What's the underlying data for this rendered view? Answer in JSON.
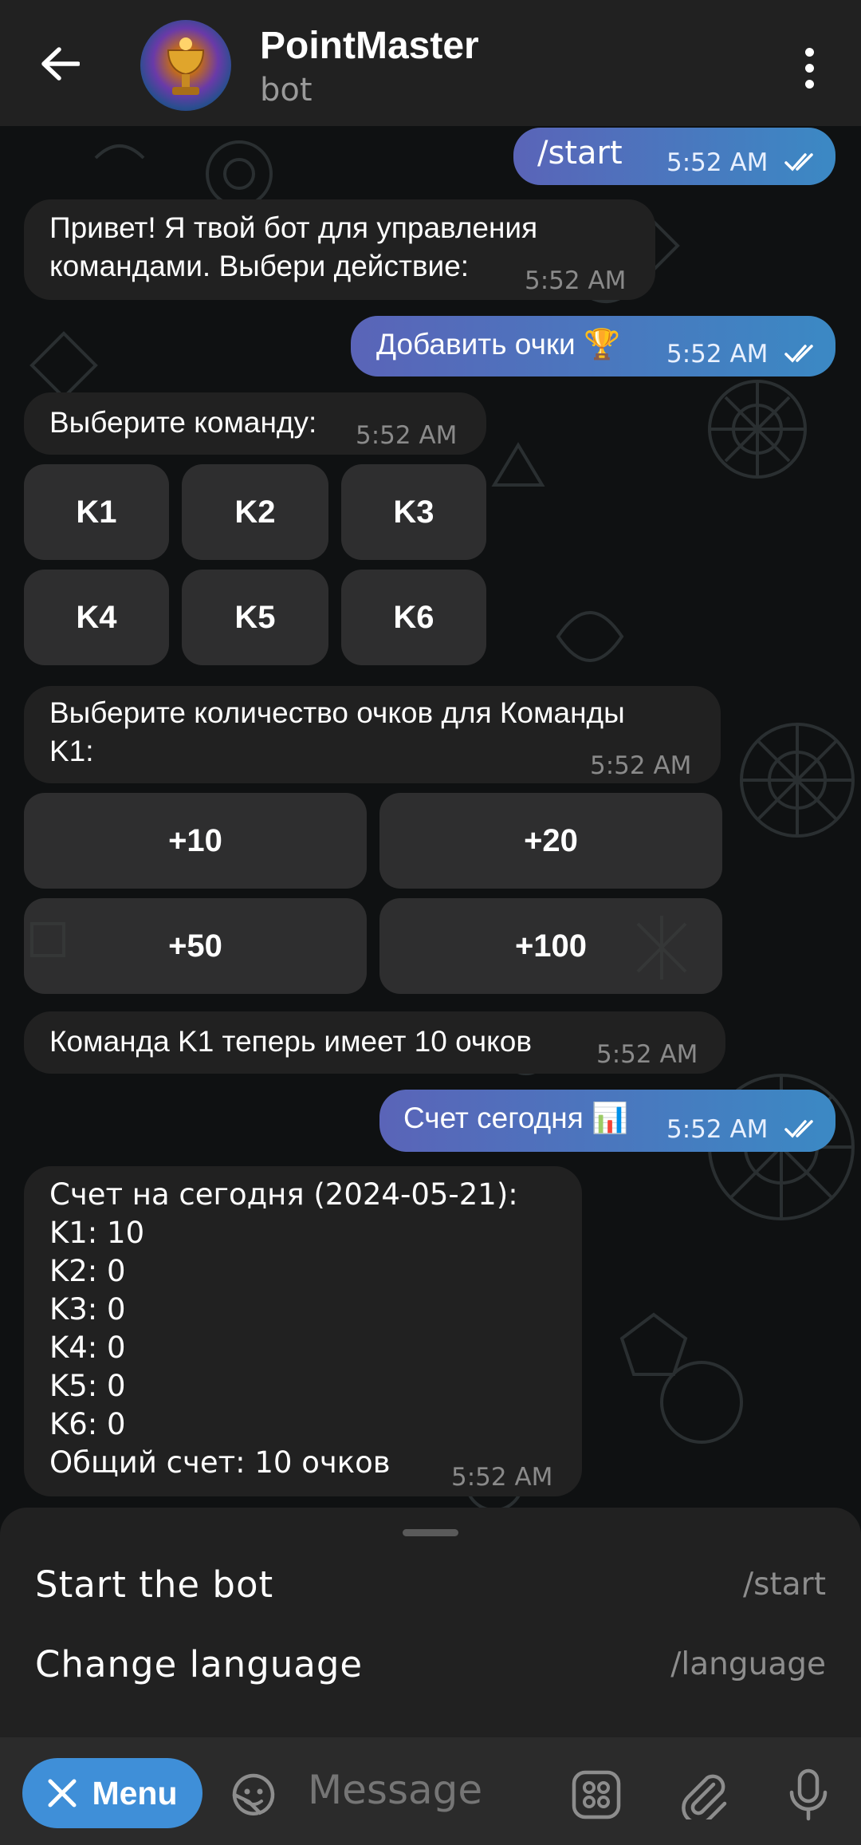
{
  "header": {
    "back_icon": "arrow-left-icon",
    "title": "PointMaster",
    "subtitle": "bot",
    "more_icon": "more-vertical-icon"
  },
  "messages": [
    {
      "type": "outgoing",
      "text": "/start",
      "time": "5:52 AM",
      "status": "read"
    },
    {
      "type": "incoming",
      "text_line1": "Привет! Я твой бот для управления",
      "text_line2": "командами. Выбери действие:",
      "time": "5:52 AM"
    },
    {
      "type": "outgoing",
      "text": "Добавить очки 🏆",
      "time": "5:52 AM",
      "status": "read"
    },
    {
      "type": "incoming",
      "text": "Выберите команду:",
      "time": "5:52 AM",
      "buttons": [
        "K1",
        "K2",
        "K3",
        "K4",
        "K5",
        "K6"
      ]
    },
    {
      "type": "incoming",
      "text_line1": "Выберите количество очков для Команды",
      "text_line2": "K1:",
      "time": "5:52 AM",
      "buttons": [
        "+10",
        "+20",
        "+50",
        "+100"
      ]
    },
    {
      "type": "incoming",
      "text": "Команда K1 теперь имеет 10 очков",
      "time": "5:52 AM"
    },
    {
      "type": "outgoing",
      "text": "Счет сегодня 📊",
      "time": "5:52 AM",
      "status": "read"
    },
    {
      "type": "incoming",
      "time": "5:52 AM",
      "lines": [
        "Счет на сегодня (2024-05-21):",
        "K1: 10",
        "K2: 0",
        "K3: 0",
        "K4: 0",
        "K5: 0",
        "K6: 0",
        "Общий счет: 10 очков"
      ]
    }
  ],
  "commands": [
    {
      "description": "Start the bot",
      "command": "/start"
    },
    {
      "description": "Change language",
      "command": "/language"
    }
  ],
  "bottom_bar": {
    "menu_label": "Menu",
    "menu_icon": "close-icon",
    "input_placeholder": "Message",
    "icons": [
      "sticker-icon",
      "bot-keyboard-icon",
      "attach-icon",
      "microphone-icon"
    ]
  },
  "colors": {
    "header_bg": "#212121",
    "incoming_bubble": "#212121",
    "outgoing_gradient_start": "#5a64b8",
    "outgoing_gradient_end": "#3b89c4",
    "accent": "#3f8fd8"
  }
}
